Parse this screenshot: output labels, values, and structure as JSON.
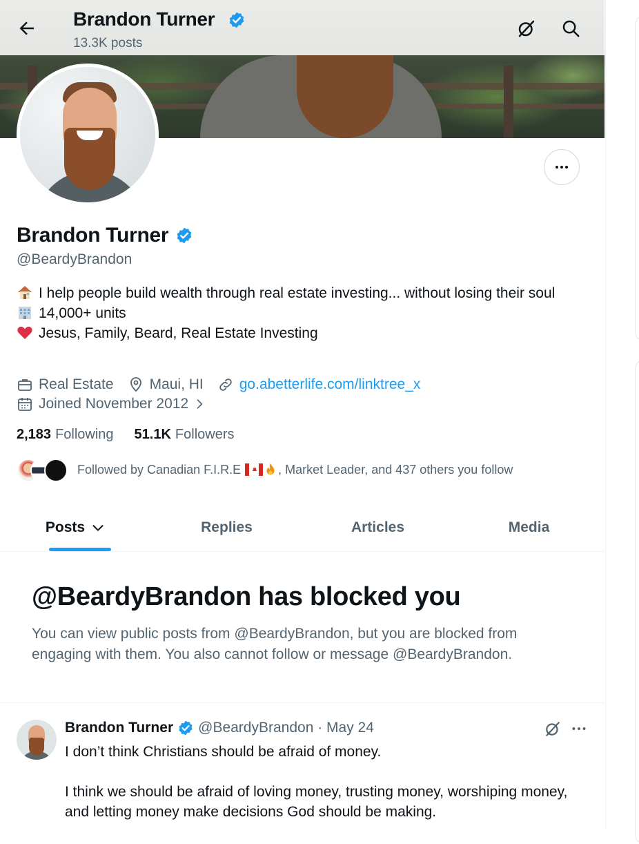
{
  "header": {
    "name": "Brandon Turner",
    "posts_count": "13.3K posts",
    "back_icon": "arrow-left-icon",
    "grok_icon": "slash-circle-icon",
    "search_icon": "search-icon"
  },
  "profile": {
    "name": "Brandon Turner",
    "handle": "@BeardyBrandon",
    "bio_lines": [
      {
        "emoji": "house-emoji",
        "text": "I help people build wealth through real estate investing... without losing their soul"
      },
      {
        "emoji": "office-building-emoji",
        "text": "14,000+ units"
      },
      {
        "emoji": "red-heart-emoji",
        "text": "Jesus, Family, Beard, Real Estate Investing"
      }
    ],
    "category": "Real Estate",
    "location": "Maui, HI",
    "website": "go.abetterlife.com/linktree_x",
    "joined": "Joined November 2012",
    "following_count": "2,183",
    "following_label": "Following",
    "followers_count": "51.1K",
    "followers_label": "Followers",
    "followed_by": "Followed by Canadian F.I.R.E",
    "followed_by_rest": ", Market Leader, and 437 others you follow"
  },
  "tabs": [
    {
      "label": "Posts",
      "active": true
    },
    {
      "label": "Replies",
      "active": false
    },
    {
      "label": "Articles",
      "active": false
    },
    {
      "label": "Media",
      "active": false
    }
  ],
  "blocked": {
    "title": "@BeardyBrandon has blocked you",
    "message": "You can view public posts from @BeardyBrandon, but you are blocked from engaging with them. You also cannot follow or message @BeardyBrandon."
  },
  "tweet": {
    "author": "Brandon Turner",
    "handle_date": "@BeardyBrandon · May 24",
    "paragraphs": [
      "I don’t think Christians should be afraid of money.",
      "I think we should be afraid of loving money, trusting money, worshiping money, and letting money make decisions God should be making."
    ]
  },
  "colors": {
    "accent": "#1d9bf0",
    "text": "#0f1419",
    "secondary": "#536471",
    "border": "#eff3f4"
  }
}
